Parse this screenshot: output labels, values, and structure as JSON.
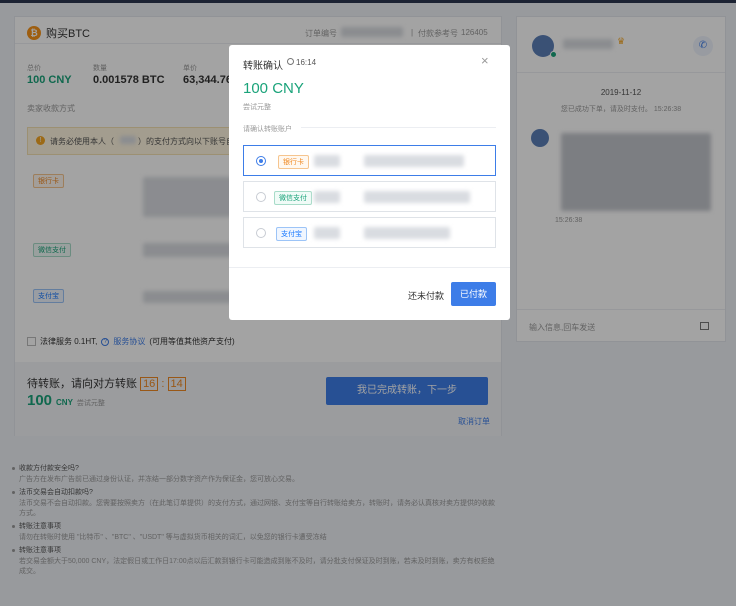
{
  "order": {
    "title": "购买BTC",
    "order_no_label": "订单编号",
    "ref_label": "付款参考号",
    "ref_value": "126405",
    "total_label": "总价",
    "total_value": "100 CNY",
    "qty_label": "数量",
    "qty_value": "0.001578 BTC",
    "price_label": "单价",
    "price_value": "63,344.76",
    "seller_methods_label": "卖家收款方式",
    "warning_text": "请务必使用本人（",
    "warning_text2": "）的支付方式向以下账号自行转账",
    "method_bank": "银行卡",
    "method_wechat": "微信支付",
    "method_alipay": "支付宝",
    "legal_label": "法律服务 0.1HT,",
    "legal_link": "服务协议",
    "legal_note": "(可用等值其他资产支付)",
    "waiting_text": "待转账，请向对方转账",
    "timer_min": "16",
    "timer_sec": "14",
    "amount_value": "100",
    "amount_unit": "CNY",
    "amount_hint": "尝试元整",
    "done_button": "我已完成转账，下一步",
    "cancel_link": "取消订单"
  },
  "notes": [
    {
      "q": "收款方付款安全吗?",
      "a": "广告方在发布广告前已通过身份认证，并冻结一部分数字资产作为保证金，您可放心交易。"
    },
    {
      "q": "法币交易会自动扣款吗?",
      "a": "法币交易不会自动扣款。您需要按照卖方（在此笔订单提供）的支付方式，通过网银、支付宝等自行转账给卖方，转账时，请务必认真核对卖方提供的收款方式。"
    },
    {
      "q": "转账注意事项",
      "a": "请勿在转账时使用 \"比特币\" 、\"BTC\" 、\"USDT\" 等与虚拟货币相关的词汇，以免您的银行卡遭受冻结"
    },
    {
      "q": "转账注意事项",
      "a": "若交易金额大于50,000 CNY，法定假日或工作日17:00点以后汇款到银行卡可能造成到账不及时，请分批支付保证及时到账，若未及时到账，卖方有权拒绝成交。"
    }
  ],
  "chat": {
    "date": "2019-11-12",
    "system_msg": "您已成功下单，请及时支付。 15:26:38",
    "msg_time": "15:26:38",
    "input_placeholder": "输入信息,回车发送"
  },
  "modal": {
    "title": "转账确认",
    "time": "16:14",
    "amount": "100 CNY",
    "amount_hint": "尝试元整",
    "confirm_label": "请确认转账账户",
    "options": [
      {
        "tag": "银行卡",
        "selected": true
      },
      {
        "tag": "微信支付",
        "selected": false
      },
      {
        "tag": "支付宝",
        "selected": false
      }
    ],
    "unpaid_button": "还未付款",
    "paid_button": "已付款"
  },
  "colors": {
    "accent": "#3d7de8",
    "green": "#1aa37a",
    "orange": "#f08a24",
    "btc": "#f7931a"
  },
  "icons": [
    "btc-icon",
    "clock-icon",
    "close-icon",
    "phone-icon",
    "image-icon",
    "warning-icon",
    "help-icon",
    "crown-icon"
  ]
}
